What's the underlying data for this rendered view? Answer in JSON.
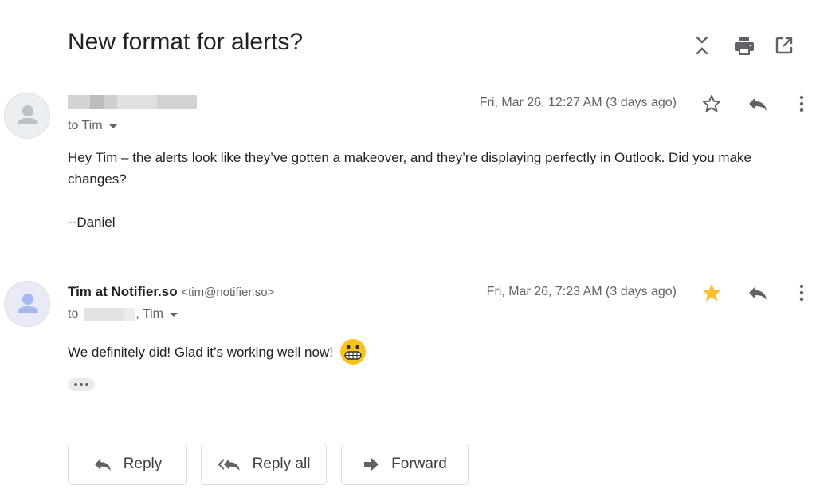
{
  "subject": "New format for alerts?",
  "top_icons": [
    "expand-collapse-icon",
    "print-icon",
    "open-in-new-window-icon"
  ],
  "messages": [
    {
      "sender_name": "",
      "sender_email": "",
      "to_label": "to Tim",
      "date": "Fri, Mar 26, 12:27 AM (3 days ago)",
      "starred": false,
      "body_line1": "Hey Tim – the alerts look like they’ve gotten a makeover, and they’re displaying perfectly in Outlook. Did you make changes?",
      "body_signature": "--Daniel"
    },
    {
      "sender_name": "Tim at Notifier.so",
      "sender_email": "<tim@notifier.so>",
      "to_prefix": "to",
      "to_suffix": ", Tim",
      "date": "Fri, Mar 26, 7:23 AM (3 days ago)",
      "starred": true,
      "body_line1": "We definitely did! Glad it’s working well now!",
      "emoji": "grinning-face-emoji"
    }
  ],
  "actions": {
    "reply": "Reply",
    "reply_all": "Reply all",
    "forward": "Forward"
  },
  "colors": {
    "star_filled": "#fbc02d",
    "icon_gray": "#5f6368",
    "avatar_gray": "#bdc1c6",
    "avatar_blue": "#a3b9f0"
  }
}
